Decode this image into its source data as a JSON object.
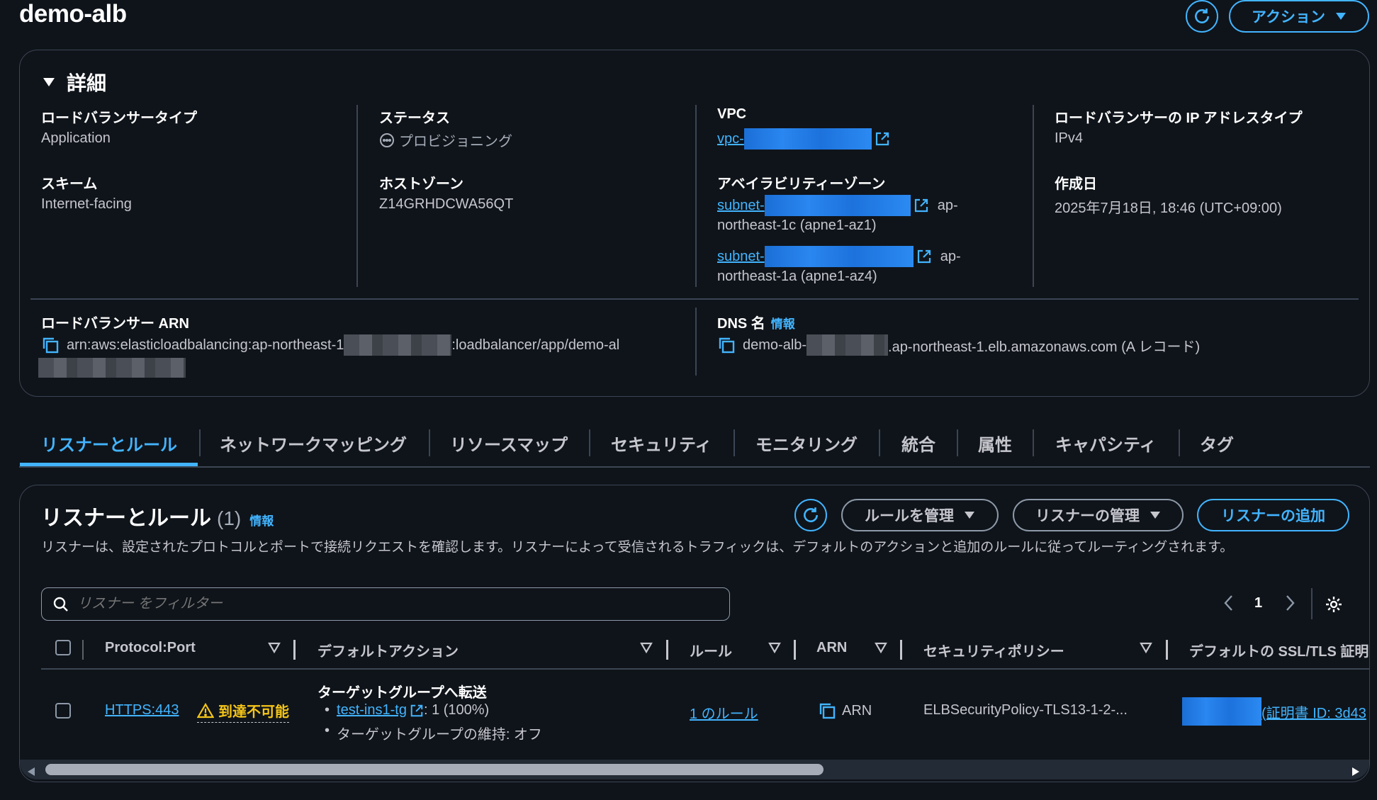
{
  "header": {
    "title": "demo-alb",
    "actions_label": "アクション"
  },
  "details": {
    "heading": "詳細",
    "lb_type_label": "ロードバランサータイプ",
    "lb_type_value": "Application",
    "status_label": "ステータス",
    "status_value": "プロビジョニング",
    "vpc_label": "VPC",
    "vpc_value": "vpc-",
    "ip_type_label": "ロードバランサーの IP アドレスタイプ",
    "ip_type_value": "IPv4",
    "scheme_label": "スキーム",
    "scheme_value": "Internet-facing",
    "hosted_zone_label": "ホストゾーン",
    "hosted_zone_value": "Z14GRHDCWA56QT",
    "az_label": "アベイラビリティーゾーン",
    "az_items": [
      {
        "subnet": "subnet-",
        "zone_prefix": "ap-",
        "zone_rest": "northeast-1c (apne1-az1)"
      },
      {
        "subnet": "subnet-",
        "zone_prefix": "ap-",
        "zone_rest": "northeast-1a (apne1-az4)"
      }
    ],
    "created_label": "作成日",
    "created_value": "2025年7月18日, 18:46 (UTC+09:00)",
    "arn_label": "ロードバランサー ARN",
    "arn_prefix": "arn:aws:elasticloadbalancing:ap-northeast-1",
    "arn_suffix": ":loadbalancer/app/demo-al",
    "dns_label": "DNS 名",
    "dns_info": "情報",
    "dns_prefix": "demo-alb-",
    "dns_suffix": ".ap-northeast-1.elb.amazonaws.com (A レコード)"
  },
  "tabs": [
    {
      "label": "リスナーとルール"
    },
    {
      "label": "ネットワークマッピング"
    },
    {
      "label": "リソースマップ"
    },
    {
      "label": "セキュリティ"
    },
    {
      "label": "モニタリング"
    },
    {
      "label": "統合"
    },
    {
      "label": "属性"
    },
    {
      "label": "キャパシティ"
    },
    {
      "label": "タグ"
    }
  ],
  "listeners": {
    "title": "リスナーとルール",
    "count": "(1)",
    "info": "情報",
    "manage_rules_label": "ルールを管理",
    "manage_listeners_label": "リスナーの管理",
    "add_listener_label": "リスナーの追加",
    "description": "リスナーは、設定されたプロトコルとポートで接続リクエストを確認します。リスナーによって受信されるトラフィックは、デフォルトのアクションと追加のルールに従ってルーティングされます。",
    "search_placeholder": "リスナー をフィルター",
    "page_number": "1",
    "columns": [
      "Protocol:Port",
      "デフォルトアクション",
      "ルール",
      "ARN",
      "セキュリティポリシー",
      "デフォルトの SSL/TLS 証明"
    ],
    "row": {
      "protocol_port": "HTTPS:443",
      "warning": "到達不可能",
      "action_title": "ターゲットグループへ転送",
      "tg_name": "test-ins1-tg",
      "tg_weight": ": 1 (100%)",
      "stickiness": "ターゲットグループの維持: オフ",
      "rules": "1 のルール",
      "arn": "ARN",
      "policy": "ELBSecurityPolicy-TLS13-1-2-...",
      "cert": "(証明書 ID: 3d43"
    }
  },
  "colors": {
    "accent": "#42b4ff",
    "background": "#0f141a",
    "warning": "#f5c518"
  }
}
